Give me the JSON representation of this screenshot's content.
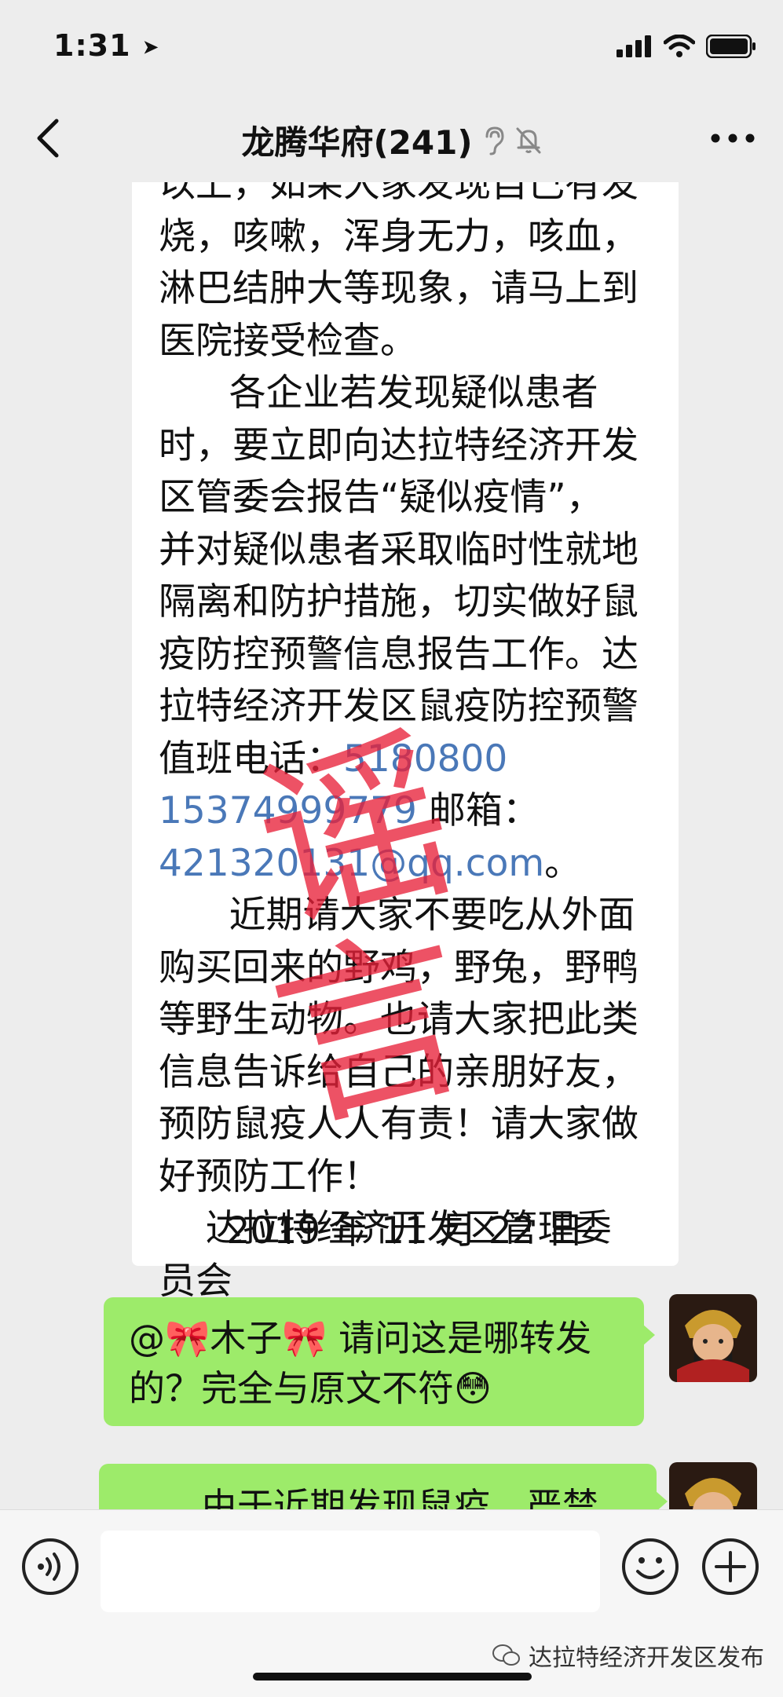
{
  "status_bar": {
    "time": "1:31"
  },
  "nav": {
    "title": "龙腾华府(241)"
  },
  "message": {
    "lines": [
      "以上，如果大家发现自己有发",
      "烧，咳嗽，浑身无力，咳血，",
      "淋巴结肿大等现象，请马上到",
      "医院接受检查。",
      "      各企业若发现疑似患者",
      "时，要立即向达拉特经济开发",
      "区管委会报告“疑似疫情”，",
      "并对疑似患者采取临时性就地",
      "隔离和防护措施，切实做好鼠",
      "疫防控预警信息报告工作。达",
      "拉特经济开发区鼠疫防控预警",
      "值班电话："
    ],
    "phone1": "5180800",
    "phone2": "15374999779",
    "email_label": " 邮箱：",
    "email": "421320131@qq.com",
    "email_suffix": "。",
    "lines2": [
      "      近期请大家不要吃从外面",
      "购买回来的野鸡，野兔，野鸭",
      "等野生动物。也请大家把此类",
      "信息告诉给自己的亲朋好友，",
      "预防鼠疫人人有责！请大家做",
      "好预防工作！",
      "    达拉特经济开发区管理委",
      "员会"
    ],
    "date": "2019 年 11 月 22 日"
  },
  "stamp_text": "谣言",
  "reply": {
    "line1": "@🎀木子🎀 请问这是哪转发",
    "line2": "的？完全与原文不符😳"
  },
  "next_bubble": {
    "partial_text": "由于近期发现鼠疫，严禁"
  },
  "watermark": {
    "text": "达拉特经济开发区发布"
  },
  "colors": {
    "bubble": "#9deb6a",
    "link": "#4a78b8",
    "stamp": "#e8213a"
  }
}
